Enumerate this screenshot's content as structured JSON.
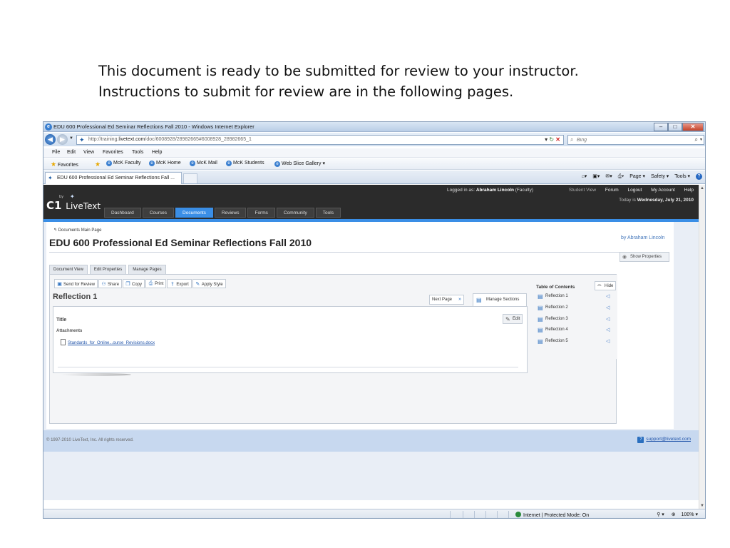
{
  "caption": {
    "line1": "This document is ready to be submitted for review to your instructor.",
    "line2": "Instructions to submit for review are in the following pages."
  },
  "browser": {
    "window_title": "EDU 600 Professional Ed Seminar Reflections Fall 2010 - Windows Internet Explorer",
    "url_prefix": "http://training.",
    "url_domain": "livetext.com",
    "url_rest": "/doc/6008928/28982665#6008928_28982665_1",
    "search_placeholder": "Bing",
    "menu": [
      "File",
      "Edit",
      "View",
      "Favorites",
      "Tools",
      "Help"
    ],
    "favorites_label": "Favorites",
    "favorites": [
      "McK Faculty",
      "McK Home",
      "McK Mail",
      "McK Students",
      "Web Slice Gallery ▾"
    ],
    "tab_title": "EDU 600 Professional Ed Seminar Reflections Fall ...",
    "commands": [
      "Page ▾",
      "Safety ▾",
      "Tools ▾"
    ],
    "status_zone": "Internet | Protected Mode: On",
    "zoom": "100%"
  },
  "livetext": {
    "logo_c1": "C1",
    "logo_by": "by",
    "logo_text": "LiveText",
    "logged_in_prefix": "Logged in as:",
    "user_name": "Abraham Lincoln",
    "user_role": "(Faculty)",
    "links": [
      "Student View",
      "Forum",
      "Logout",
      "My Account",
      "Help"
    ],
    "date_prefix": "Today is",
    "date": "Wednesday, July 21, 2010",
    "nav": [
      "Dashboard",
      "Courses",
      "Documents",
      "Reviews",
      "Forms",
      "Community",
      "Tools"
    ],
    "nav_active": "Documents",
    "breadcrumb": "Documents Main Page",
    "doc_title": "EDU 600 Professional Ed Seminar Reflections Fall 2010",
    "by_author": "by Abraham Lincoln",
    "show_properties": "Show Properties",
    "doc_tabs": [
      "Document View",
      "Edit Properties",
      "Manage Pages"
    ],
    "toolbar": [
      "Send for Review",
      "Share",
      "Copy",
      "Print",
      "Export",
      "Apply Style"
    ],
    "page_title": "Reflection 1",
    "next_page": "Next Page",
    "manage_sections": "Manage Sections",
    "section_title": "Title",
    "edit": "Edit",
    "attachments_label": "Attachments",
    "attachment": "Standards_for_Online...ourse_Revisions.docx",
    "toc_heading": "Table of Contents",
    "toc_hide": "Hide",
    "toc_items": [
      "Reflection 1",
      "Reflection 2",
      "Reflection 3",
      "Reflection 4",
      "Reflection 5"
    ],
    "copyright": "© 1997-2010 LiveText, Inc. All rights reserved.",
    "support": "support@livetext.com"
  }
}
